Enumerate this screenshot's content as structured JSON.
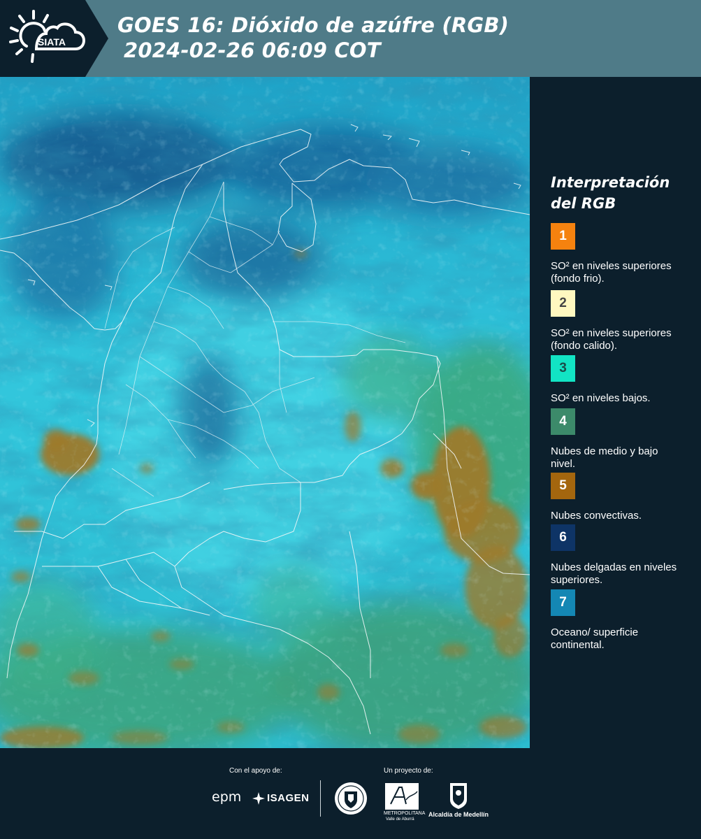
{
  "header": {
    "logo_text": "SIATA",
    "title_line1": "GOES 16: Dióxido de azúfre (RGB)",
    "title_line2": "2024-02-26 06:09 COT"
  },
  "legend": {
    "title_line1": "Interpretación",
    "title_line2": "del RGB",
    "items": [
      {
        "number": "1",
        "color": "#f5820f",
        "label": "SO² en niveles superiores (fondo frio)."
      },
      {
        "number": "2",
        "color": "#fff8c0",
        "label": "SO² en niveles superiores (fondo calido)."
      },
      {
        "number": "3",
        "color": "#12e4c4",
        "label": "SO² en niveles bajos."
      },
      {
        "number": "4",
        "color": "#3c8a6a",
        "label": "Nubes de medio y bajo nivel."
      },
      {
        "number": "5",
        "color": "#a4660e",
        "label": "Nubes convectivas."
      },
      {
        "number": "6",
        "color": "#0e3466",
        "label": "Nubes delgadas en niveles superiores."
      },
      {
        "number": "7",
        "color": "#1487b4",
        "label": "Oceano/ superficie continental."
      }
    ]
  },
  "footer": {
    "support_label": "Con el apoyo de:",
    "project_label": "Un proyecto de:",
    "logos": {
      "epm": "epm",
      "isagen": "ISAGEN",
      "area_metropolitana": "METROPOLITANA",
      "area_metropolitana_sub": "Valle de Aburrá",
      "alcaldia": "Alcaldía de Medellín"
    }
  },
  "colors": {
    "background": "#0c1f2c",
    "header_bar": "#4f7b88",
    "map_base": "#27b9d4"
  }
}
